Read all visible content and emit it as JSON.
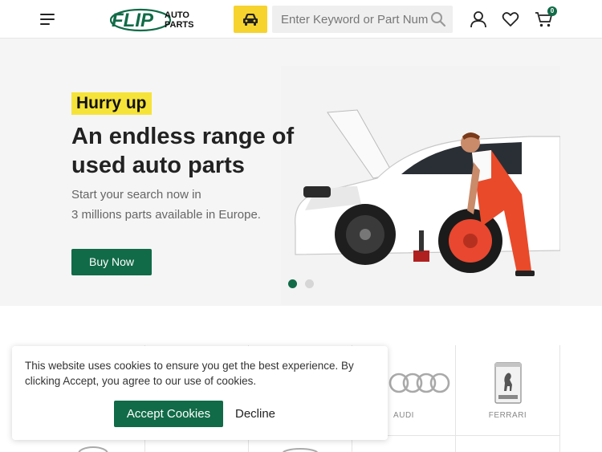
{
  "header": {
    "search_placeholder": "Enter Keyword or Part Number",
    "cart_count": "0",
    "logo": {
      "word1": "FLIP",
      "word2": "AUTO",
      "word3": "PARTS"
    },
    "colors": {
      "brand_green": "#116b48",
      "accent_yellow": "#f6d32d"
    },
    "icons": [
      "menu-icon",
      "car-icon",
      "search-icon",
      "user-icon",
      "heart-icon",
      "cart-icon"
    ]
  },
  "hero": {
    "badge": "Hurry up",
    "title": "An endless range of used auto parts",
    "subtitle_line1": "Start your search now in",
    "subtitle_line2": "3 millions parts available in Europe.",
    "cta": "Buy Now",
    "slides_total": 2,
    "active_slide": 1
  },
  "brands": [
    {
      "name": "AUDI"
    },
    {
      "name": "FERRARI"
    }
  ],
  "cookie": {
    "text": "This website uses cookies to ensure you get the best experience. By clicking Accept, you agree to our use of cookies.",
    "accept_label": "Accept Cookies",
    "decline_label": "Decline"
  }
}
